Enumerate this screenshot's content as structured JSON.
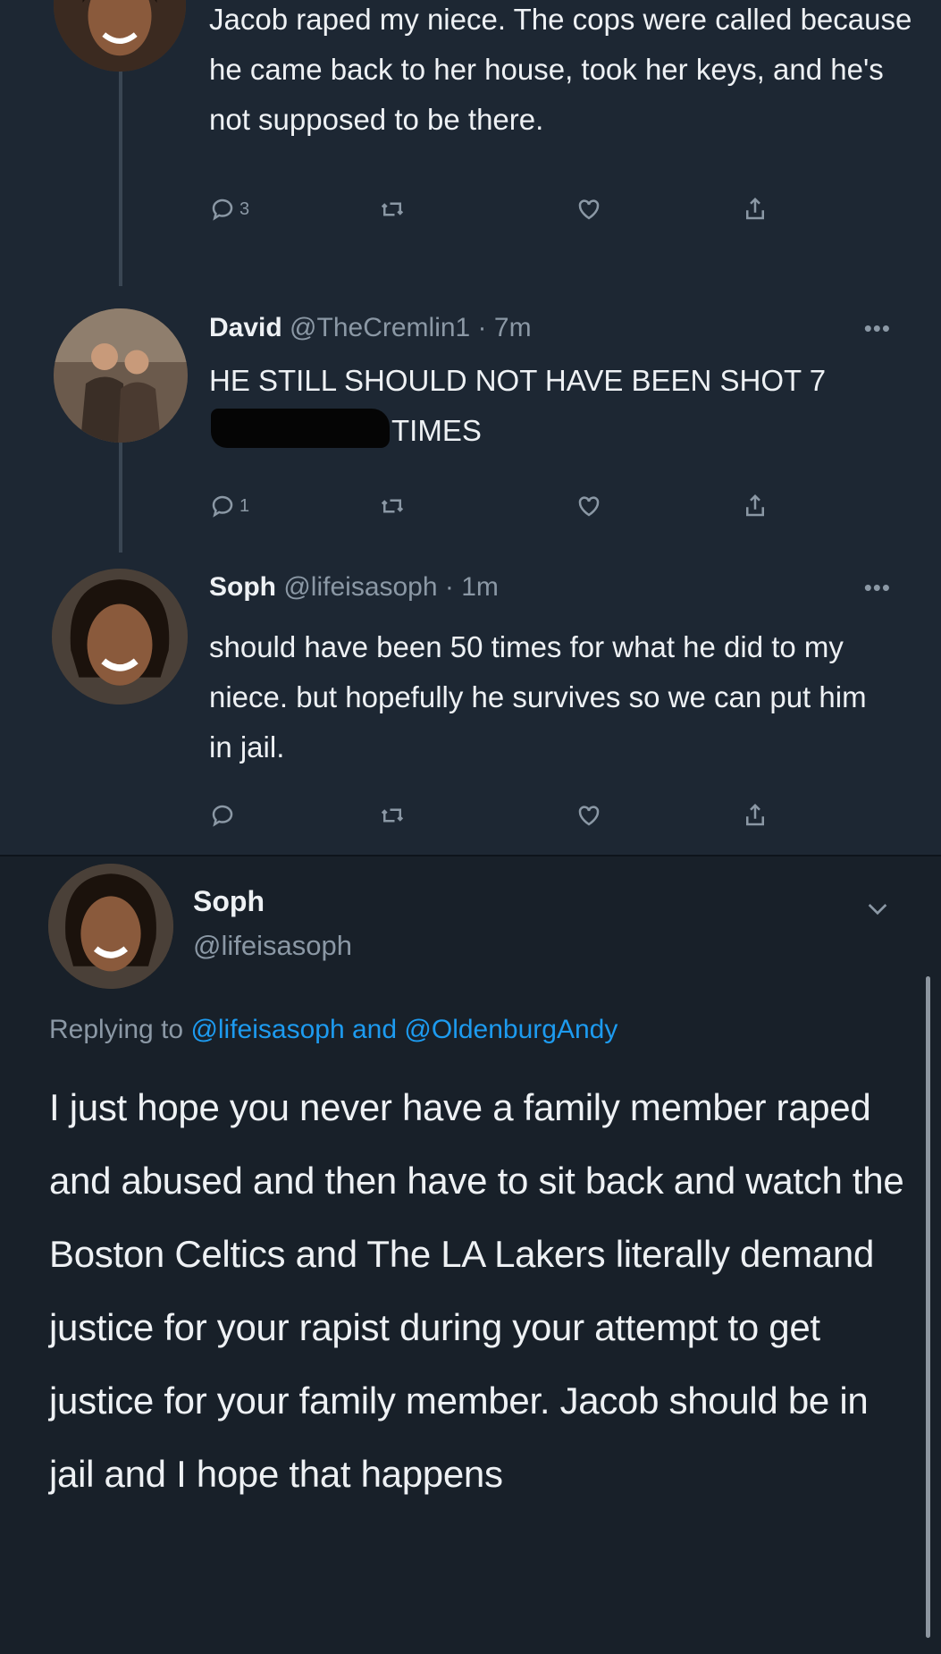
{
  "thread": {
    "first_tweet": {
      "text": "Jacob raped my niece. The cops were called because he came back to her house, took her keys, and he's not supposed to be there.",
      "reply_count": "3"
    },
    "second_tweet": {
      "name": "David",
      "meta": "@TheCremlin1 · 7m",
      "more": "•••",
      "text_before": "HE STILL SHOULD NOT HAVE BEEN SHOT 7",
      "text_after": "TIMES",
      "reply_count": "1"
    },
    "third_tweet": {
      "name": "Soph",
      "meta": "@lifeisasoph · 1m",
      "more": "•••",
      "text": "should have been 50 times for what he did to my niece. but hopefully he survives so we can put him in jail.",
      "reply_count": ""
    }
  },
  "main_tweet": {
    "name": "Soph",
    "handle": "@lifeisasoph",
    "replying_prefix": "Replying to",
    "reply_user_1": "@lifeisasoph",
    "reply_and": "and",
    "reply_user_2": "@OldenburgAndy",
    "text": "I just hope you never have a family member raped and abused and then have to sit back and watch the Boston Celtics and The LA Lakers literally demand justice for your rapist during your attempt to get justice for your family member. Jacob should be in jail and I hope that happens"
  },
  "icons": {
    "reply": "reply-icon",
    "retweet": "retweet-icon",
    "like": "heart-icon",
    "share": "share-icon",
    "chevron": "chevron-down-icon"
  },
  "colors": {
    "background_top": "#1d2733",
    "background_bottom": "#182029",
    "link": "#1d9bf0",
    "secondary_text": "#8b98a5"
  }
}
